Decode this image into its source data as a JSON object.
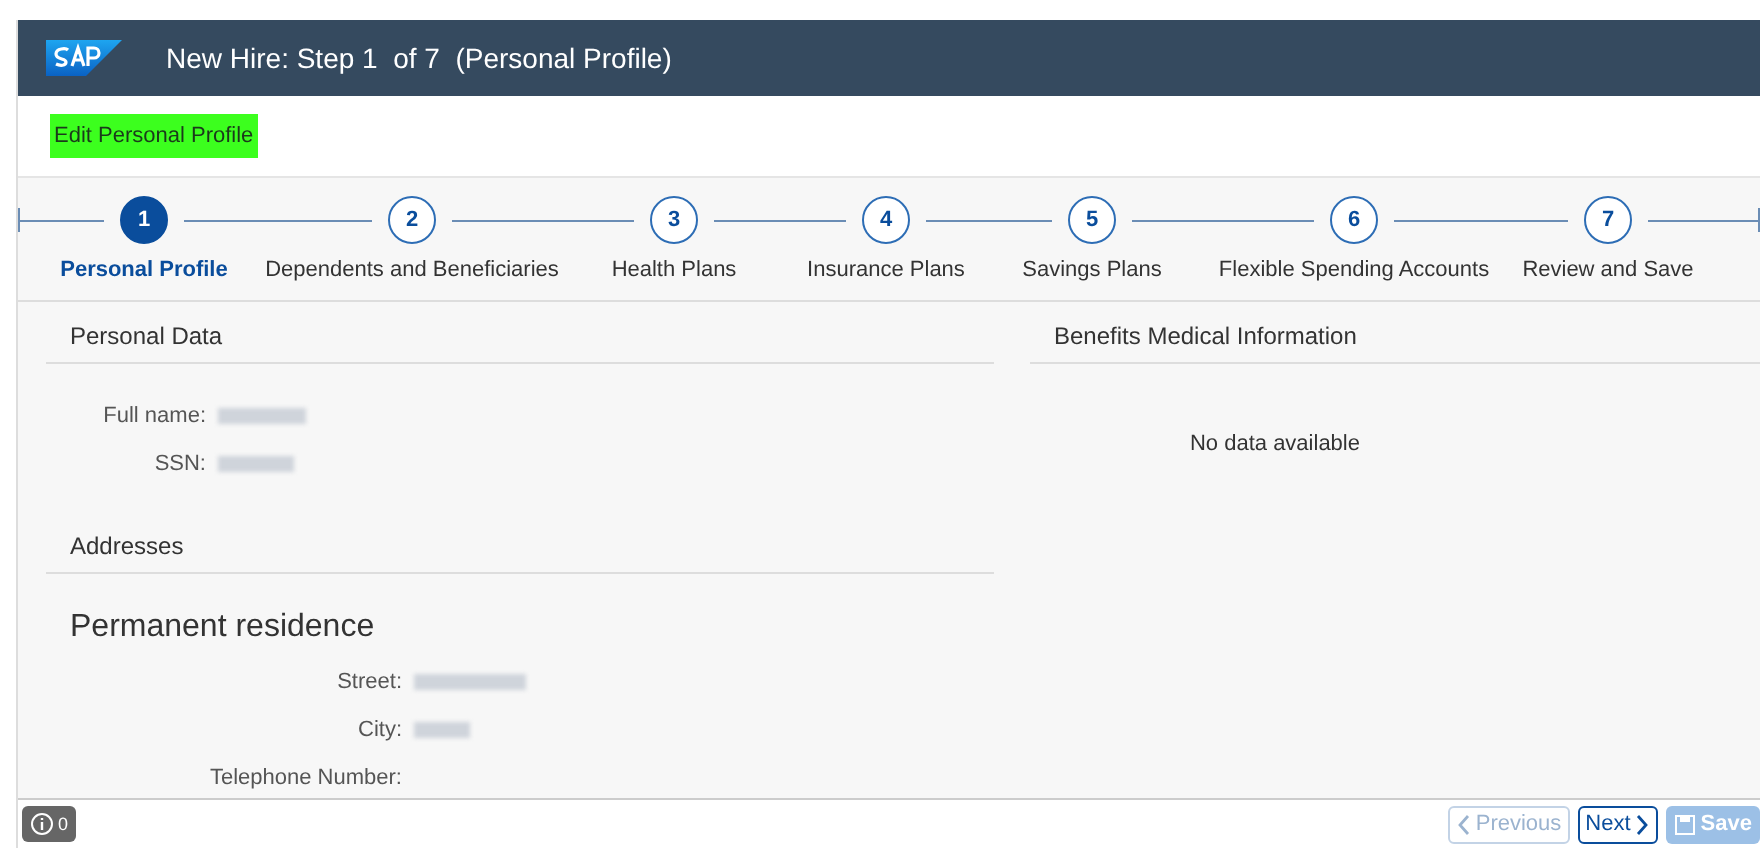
{
  "window": {
    "title": "New Hire: Step 1  of 7  (Personal Profile)"
  },
  "subheader": {
    "title": "Edit Personal Profile"
  },
  "steps": [
    {
      "number": "1",
      "label": "Personal Profile",
      "selected": true
    },
    {
      "number": "2",
      "label": "Dependents and Beneficiaries",
      "selected": false
    },
    {
      "number": "3",
      "label": "Health Plans",
      "selected": false
    },
    {
      "number": "4",
      "label": "Insurance Plans",
      "selected": false
    },
    {
      "number": "5",
      "label": "Savings Plans",
      "selected": false
    },
    {
      "number": "6",
      "label": "Flexible Spending Accounts",
      "selected": false
    },
    {
      "number": "7",
      "label": "Review and Save",
      "selected": false
    }
  ],
  "personal_data": {
    "title": "Personal Data",
    "fields": [
      {
        "label": "Full name:",
        "redacted": true
      },
      {
        "label": "SSN:",
        "redacted": true
      }
    ]
  },
  "addresses": {
    "title": "Addresses",
    "subtitle": "Permanent residence",
    "fields": [
      {
        "label": "Street:",
        "redacted": true
      },
      {
        "label": "City:",
        "redacted": true
      },
      {
        "label": "Telephone Number:"
      }
    ]
  },
  "medical": {
    "title": "Benefits Medical Information",
    "empty_text": "No data available"
  },
  "footer": {
    "message_count": "0",
    "buttons": [
      {
        "label": "Previous",
        "kind": "prev",
        "disabled": true
      },
      {
        "label": "Next",
        "kind": "next",
        "disabled": false
      },
      {
        "label": "Save",
        "kind": "save",
        "disabled": true
      }
    ]
  }
}
